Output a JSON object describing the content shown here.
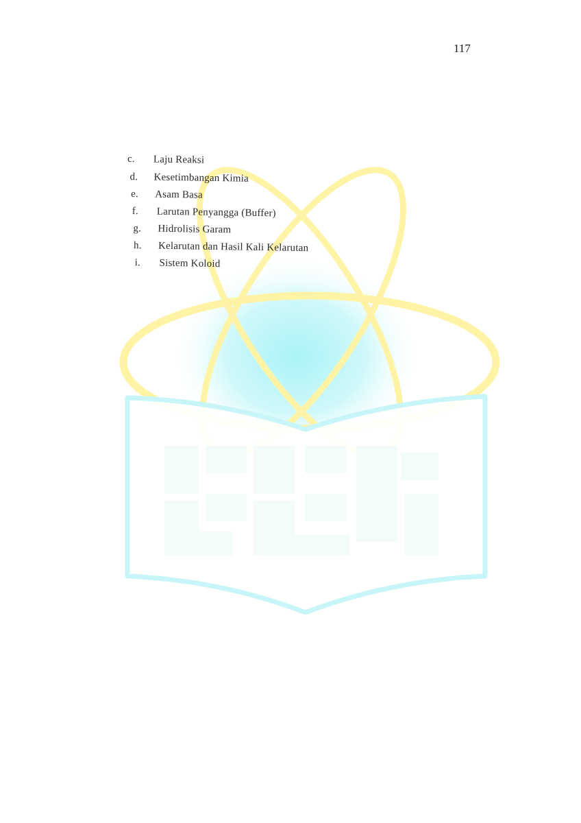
{
  "page": {
    "page_number": "117"
  },
  "toc": {
    "items": [
      {
        "letter": "c.",
        "label": "Laju Reaksi"
      },
      {
        "letter": "d.",
        "label": "Kesetimbangan Kimia"
      },
      {
        "letter": "e.",
        "label": "Asam Basa"
      },
      {
        "letter": "f.",
        "label": "Larutan Penyangga (Buffer)"
      },
      {
        "letter": "g.",
        "label": "Hidrolisis Garam"
      },
      {
        "letter": "h.",
        "label": "Kelarutan dan Hasil Kali Kelarutan"
      },
      {
        "letter": "i.",
        "label": "Sistem Koloid"
      }
    ]
  },
  "watermark": {
    "icon": "atom-book-logo-icon",
    "colors": {
      "orbit": "#fff3a6",
      "nucleus": "#a9f3f6",
      "book": "#c8f6f8",
      "letters": "#f3fbfb"
    }
  }
}
